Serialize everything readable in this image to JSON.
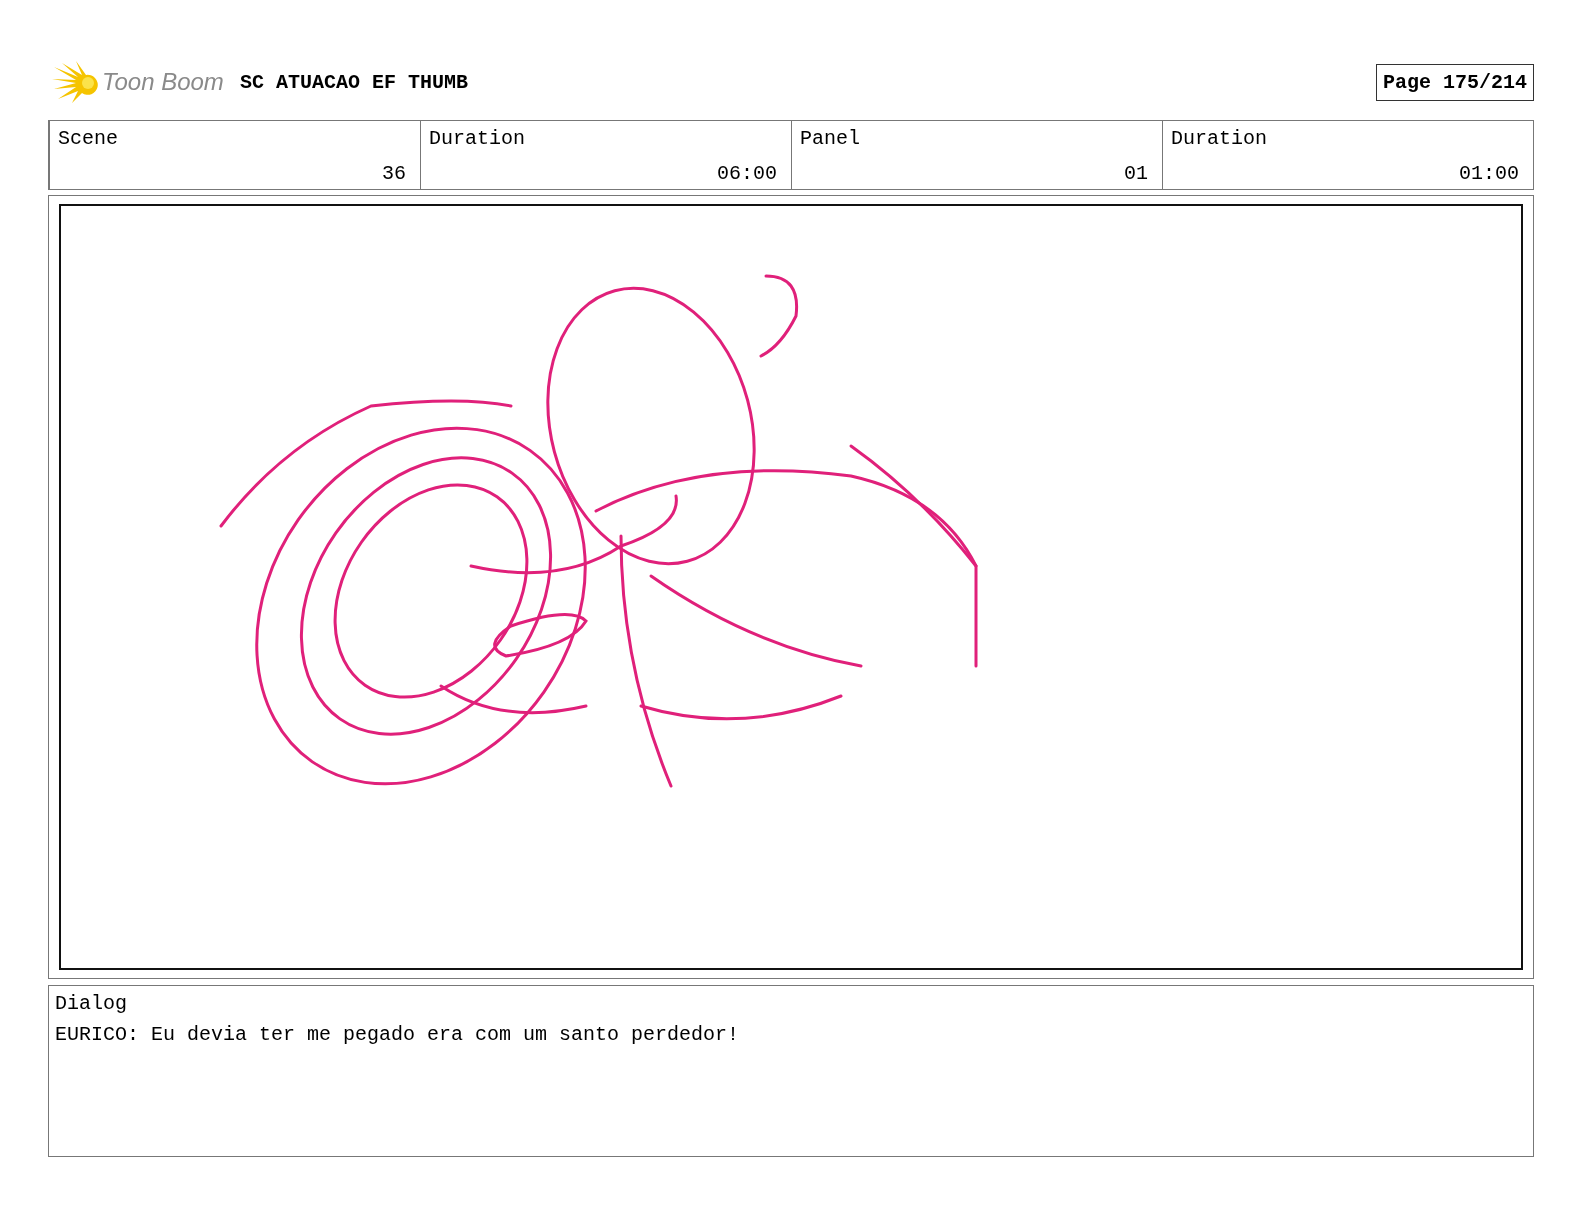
{
  "header": {
    "logo_text": "Toon Boom",
    "title": "SC ATUACAO EF THUMB",
    "page": "Page 175/214"
  },
  "fields": [
    {
      "label": "Scene",
      "value": "36"
    },
    {
      "label": "Duration",
      "value": "06:00"
    },
    {
      "label": "Panel",
      "value": "01"
    },
    {
      "label": "Duration",
      "value": "01:00"
    }
  ],
  "dialog": {
    "label": "Dialog",
    "text": "EURICO: Eu devia ter me pegado era com um santo perdedor!"
  }
}
